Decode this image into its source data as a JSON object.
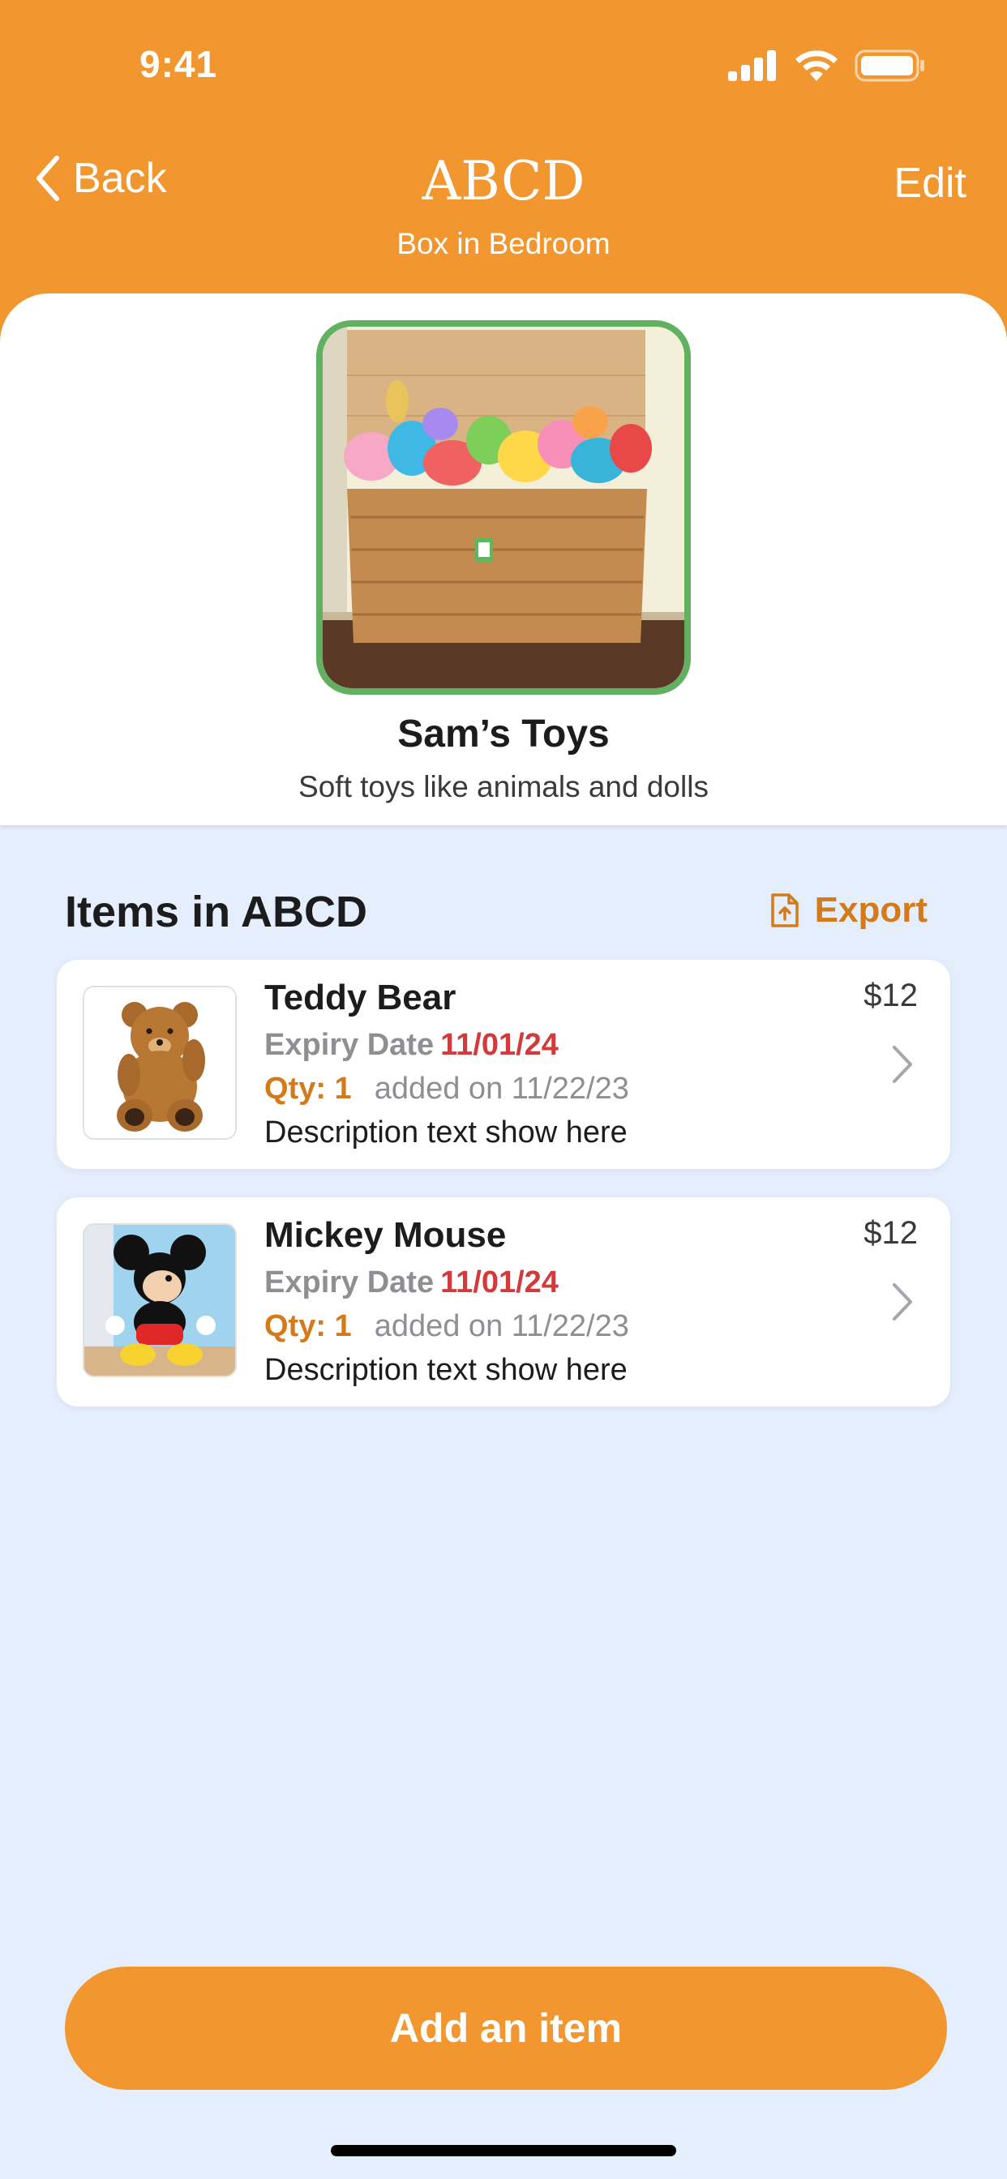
{
  "status_bar": {
    "time": "9:41"
  },
  "nav": {
    "back_label": "Back",
    "edit_label": "Edit",
    "title": "ABCD",
    "subtitle": "Box in Bedroom"
  },
  "box": {
    "name": "Sam’s Toys",
    "description": "Soft toys like animals and dolls"
  },
  "items_section": {
    "title": "Items in ABCD",
    "export_label": "Export"
  },
  "items": [
    {
      "name": "Teddy Bear",
      "expiry_label": "Expiry Date",
      "expiry_date": "11/01/24",
      "qty": "Qty: 1",
      "added": "added on 11/22/23",
      "description": "Description text show here",
      "price": "$12",
      "thumbnail_icon": "teddy-bear-photo"
    },
    {
      "name": "Mickey Mouse",
      "expiry_label": "Expiry Date",
      "expiry_date": "11/01/24",
      "qty": "Qty: 1",
      "added": "added on 11/22/23",
      "description": "Description text show here",
      "price": "$12",
      "thumbnail_icon": "mickey-mouse-photo"
    }
  ],
  "add_button_label": "Add an item",
  "colors": {
    "accent": "#f29630",
    "accent_text": "#d47a1a",
    "expiry_date": "#d23b3b",
    "photo_border": "#62b061",
    "background": "#e4eefc"
  }
}
